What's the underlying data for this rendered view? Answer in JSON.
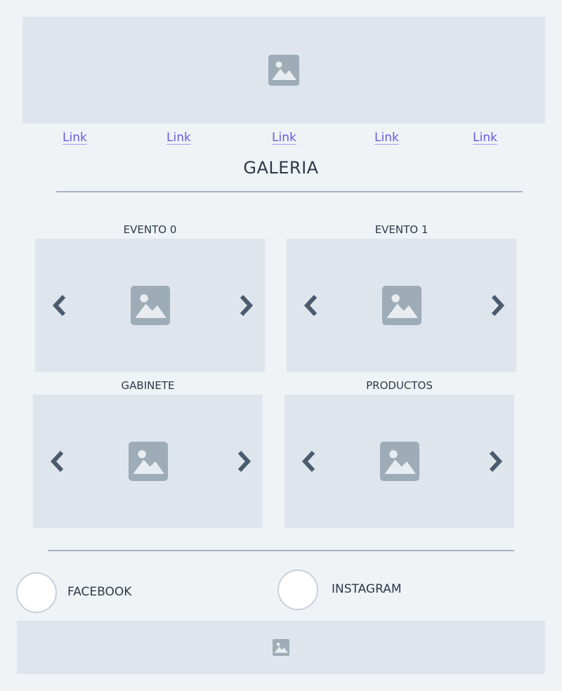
{
  "header": {
    "banner_icon": "image-placeholder-icon"
  },
  "nav": {
    "links": [
      {
        "label": "Link"
      },
      {
        "label": "Link"
      },
      {
        "label": "Link"
      },
      {
        "label": "Link"
      },
      {
        "label": "Link"
      }
    ]
  },
  "page": {
    "title": "GALERIA"
  },
  "gallery": {
    "cards": [
      {
        "label": "EVENTO 0",
        "prev_icon": "chevron-left-icon",
        "next_icon": "chevron-right-icon"
      },
      {
        "label": "EVENTO 1",
        "prev_icon": "chevron-left-icon",
        "next_icon": "chevron-right-icon"
      },
      {
        "label": "GABINETE",
        "prev_icon": "chevron-left-icon",
        "next_icon": "chevron-right-icon"
      },
      {
        "label": "PRODUCTOS",
        "prev_icon": "chevron-left-icon",
        "next_icon": "chevron-right-icon"
      }
    ]
  },
  "social": {
    "facebook_label": "FACEBOOK",
    "instagram_label": "INSTAGRAM"
  },
  "footer": {
    "banner_icon": "image-placeholder-icon"
  },
  "colors": {
    "background": "#eff3f6",
    "placeholder": "#dfe5ec",
    "icon": "#9eacb8",
    "arrow": "#4a5b6e",
    "link": "#6b57e0",
    "rule": "#a6b2c1"
  }
}
